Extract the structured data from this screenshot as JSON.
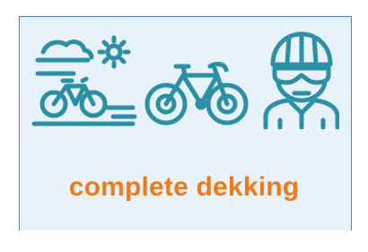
{
  "colors": {
    "icon": "#2b8fa6",
    "accent": "#f07a1a",
    "background": "#e8f2fb",
    "border": "#4a86c8"
  },
  "icons": [
    "scenic-cycling-icon",
    "racing-bicycle-icon",
    "cyclist-helmet-icon"
  ],
  "tagline": "complete dekking"
}
